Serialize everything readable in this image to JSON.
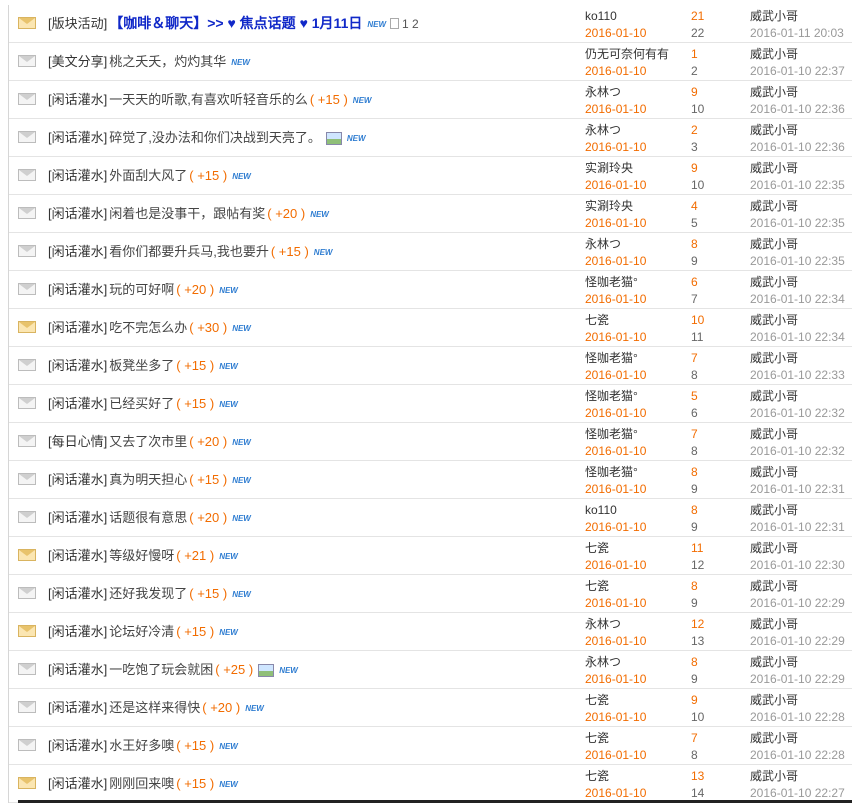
{
  "threads": [
    {
      "cat": "[版块活动]",
      "title": "【咖啡＆聊天】>> ♥ 焦点话题 ♥ 1月11日",
      "reward": "",
      "highlight": true,
      "hot": true,
      "image": false,
      "new": "NEW",
      "pages": "1 2",
      "author": "ko110",
      "post_date": "2016-01-10",
      "replies": "21",
      "views": "22",
      "last_user": "威武小哥",
      "last_time": "2016-01-11 20:03"
    },
    {
      "cat": "[美文分享]",
      "title": "桃之夭夭，灼灼其华",
      "reward": "",
      "hot": false,
      "image": false,
      "new": "NEW",
      "author": "仍无可奈何有有",
      "post_date": "2016-01-10",
      "replies": "1",
      "views": "2",
      "last_user": "威武小哥",
      "last_time": "2016-01-10 22:37"
    },
    {
      "cat": "[闲话灌水]",
      "title": "一天天的听歌,有喜欢听轻音乐的么",
      "reward": "( +15 )",
      "hot": false,
      "image": false,
      "new": "NEW",
      "author": "永林つ",
      "post_date": "2016-01-10",
      "replies": "9",
      "views": "10",
      "last_user": "威武小哥",
      "last_time": "2016-01-10 22:36"
    },
    {
      "cat": "[闲话灌水]",
      "title": "碎觉了,没办法和你们决战到天亮了。",
      "reward": "",
      "hot": false,
      "image": true,
      "new": "NEW",
      "author": "永林つ",
      "post_date": "2016-01-10",
      "replies": "2",
      "views": "3",
      "last_user": "威武小哥",
      "last_time": "2016-01-10 22:36"
    },
    {
      "cat": "[闲话灌水]",
      "title": "外面刮大风了",
      "reward": "( +15 )",
      "hot": false,
      "image": false,
      "new": "NEW",
      "author": "实涮玲央",
      "post_date": "2016-01-10",
      "replies": "9",
      "views": "10",
      "last_user": "威武小哥",
      "last_time": "2016-01-10 22:35"
    },
    {
      "cat": "[闲话灌水]",
      "title": "闲着也是没事干，跟帖有奖",
      "reward": "( +20 )",
      "hot": false,
      "image": false,
      "new": "NEW",
      "author": "实涮玲央",
      "post_date": "2016-01-10",
      "replies": "4",
      "views": "5",
      "last_user": "威武小哥",
      "last_time": "2016-01-10 22:35"
    },
    {
      "cat": "[闲话灌水]",
      "title": "看你们都要升兵马,我也要升",
      "reward": "( +15 )",
      "hot": false,
      "image": false,
      "new": "NEW",
      "author": "永林つ",
      "post_date": "2016-01-10",
      "replies": "8",
      "views": "9",
      "last_user": "威武小哥",
      "last_time": "2016-01-10 22:35"
    },
    {
      "cat": "[闲话灌水]",
      "title": "玩的可好啊",
      "reward": "( +20 )",
      "hot": false,
      "image": false,
      "new": "NEW",
      "author": "怪咖老猫°",
      "post_date": "2016-01-10",
      "replies": "6",
      "views": "7",
      "last_user": "威武小哥",
      "last_time": "2016-01-10 22:34"
    },
    {
      "cat": "[闲话灌水]",
      "title": "吃不完怎么办",
      "reward": "( +30 )",
      "hot": true,
      "image": false,
      "new": "NEW",
      "author": "七瓷",
      "post_date": "2016-01-10",
      "replies": "10",
      "views": "11",
      "last_user": "威武小哥",
      "last_time": "2016-01-10 22:34"
    },
    {
      "cat": "[闲话灌水]",
      "title": "板凳坐多了",
      "reward": "( +15 )",
      "hot": false,
      "image": false,
      "new": "NEW",
      "author": "怪咖老猫°",
      "post_date": "2016-01-10",
      "replies": "7",
      "views": "8",
      "last_user": "威武小哥",
      "last_time": "2016-01-10 22:33"
    },
    {
      "cat": "[闲话灌水]",
      "title": "已经买好了",
      "reward": "( +15 )",
      "hot": false,
      "image": false,
      "new": "NEW",
      "author": "怪咖老猫°",
      "post_date": "2016-01-10",
      "replies": "5",
      "views": "6",
      "last_user": "威武小哥",
      "last_time": "2016-01-10 22:32"
    },
    {
      "cat": "[每日心情]",
      "title": "又去了次市里",
      "reward": "( +20 )",
      "hot": false,
      "image": false,
      "new": "NEW",
      "author": "怪咖老猫°",
      "post_date": "2016-01-10",
      "replies": "7",
      "views": "8",
      "last_user": "威武小哥",
      "last_time": "2016-01-10 22:32"
    },
    {
      "cat": "[闲话灌水]",
      "title": "真为明天担心",
      "reward": "( +15 )",
      "hot": false,
      "image": false,
      "new": "NEW",
      "author": "怪咖老猫°",
      "post_date": "2016-01-10",
      "replies": "8",
      "views": "9",
      "last_user": "威武小哥",
      "last_time": "2016-01-10 22:31"
    },
    {
      "cat": "[闲话灌水]",
      "title": "话题很有意思",
      "reward": "( +20 )",
      "hot": false,
      "image": false,
      "new": "NEW",
      "author": "ko110",
      "post_date": "2016-01-10",
      "replies": "8",
      "views": "9",
      "last_user": "威武小哥",
      "last_time": "2016-01-10 22:31"
    },
    {
      "cat": "[闲话灌水]",
      "title": "等级好慢呀",
      "reward": "( +21 )",
      "hot": true,
      "image": false,
      "new": "NEW",
      "author": "七瓷",
      "post_date": "2016-01-10",
      "replies": "11",
      "views": "12",
      "last_user": "威武小哥",
      "last_time": "2016-01-10 22:30"
    },
    {
      "cat": "[闲话灌水]",
      "title": "还好我发现了",
      "reward": "( +15 )",
      "hot": false,
      "image": false,
      "new": "NEW",
      "author": "七瓷",
      "post_date": "2016-01-10",
      "replies": "8",
      "views": "9",
      "last_user": "威武小哥",
      "last_time": "2016-01-10 22:29"
    },
    {
      "cat": "[闲话灌水]",
      "title": "论坛好冷清",
      "reward": "( +15 )",
      "hot": true,
      "image": false,
      "new": "NEW",
      "author": "永林つ",
      "post_date": "2016-01-10",
      "replies": "12",
      "views": "13",
      "last_user": "威武小哥",
      "last_time": "2016-01-10 22:29"
    },
    {
      "cat": "[闲话灌水]",
      "title": "一吃饱了玩会就困",
      "reward": "( +25 )",
      "hot": false,
      "image": true,
      "new": "NEW",
      "author": "永林つ",
      "post_date": "2016-01-10",
      "replies": "8",
      "views": "9",
      "last_user": "威武小哥",
      "last_time": "2016-01-10 22:29"
    },
    {
      "cat": "[闲话灌水]",
      "title": "还是这样来得快",
      "reward": "( +20 )",
      "hot": false,
      "image": false,
      "new": "NEW",
      "author": "七瓷",
      "post_date": "2016-01-10",
      "replies": "9",
      "views": "10",
      "last_user": "威武小哥",
      "last_time": "2016-01-10 22:28"
    },
    {
      "cat": "[闲话灌水]",
      "title": "水王好多噢",
      "reward": "( +15 )",
      "hot": false,
      "image": false,
      "new": "NEW",
      "author": "七瓷",
      "post_date": "2016-01-10",
      "replies": "7",
      "views": "8",
      "last_user": "威武小哥",
      "last_time": "2016-01-10 22:28"
    },
    {
      "cat": "[闲话灌水]",
      "title": "刚刚回来噢",
      "reward": "( +15 )",
      "hot": true,
      "image": false,
      "new": "NEW",
      "author": "七瓷",
      "post_date": "2016-01-10",
      "replies": "13",
      "views": "14",
      "last_user": "威武小哥",
      "last_time": "2016-01-10 22:27"
    }
  ]
}
